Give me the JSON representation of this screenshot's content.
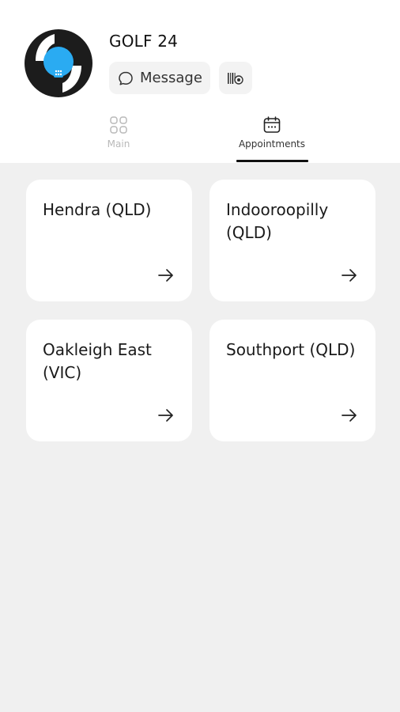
{
  "profile": {
    "name": "GOLF 24",
    "logo_icon": "golf-24-logo",
    "message_button": {
      "label": "Message",
      "icon": "chat-bubble-icon"
    },
    "barcode_button": {
      "icon": "barcode-card-icon"
    }
  },
  "tabs": [
    {
      "label": "Main",
      "icon": "grid-icon",
      "active": false
    },
    {
      "label": "Appointments",
      "icon": "calendar-icon",
      "active": true
    }
  ],
  "locations": [
    {
      "name": "Hendra (QLD)"
    },
    {
      "name": "Indooroopilly (QLD)"
    },
    {
      "name": "Oakleigh East (VIC)"
    },
    {
      "name": "Southport (QLD)"
    }
  ],
  "colors": {
    "accent": "#2aabf2",
    "logo_dark": "#1c1c1c",
    "background": "#f0f0f0",
    "card": "#ffffff"
  }
}
